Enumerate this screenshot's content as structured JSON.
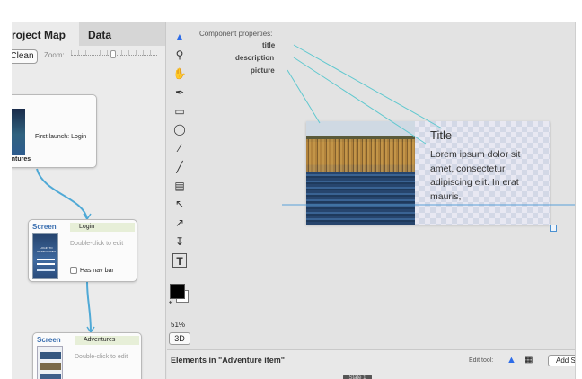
{
  "tabs": {
    "project_map": "roject Map",
    "data": "Data"
  },
  "toolbar": {
    "clean": "Clean",
    "zoom_label": "Zoom:"
  },
  "map": {
    "first": {
      "side_label": "n",
      "caption": "First launch: Login",
      "bottom": "ventures"
    },
    "login": {
      "header": "Screen",
      "name": "Login",
      "hint": "Double-click to edit",
      "navbar": "Has nav bar",
      "phone_text": "LOGIN TO ADVENTURES"
    },
    "adventures": {
      "header": "Screen",
      "name": "Adventures",
      "hint": "Double-click to edit"
    }
  },
  "tools": {
    "icons": [
      "pointer-icon",
      "magnifier-icon",
      "hand-icon",
      "pen-icon",
      "rectangle-icon",
      "oval-icon",
      "brush-icon",
      "line-icon",
      "gradient-icon",
      "direct-select-icon",
      "add-point-icon",
      "text-height-icon",
      "text-icon"
    ],
    "zoom_pct": "51%",
    "btn_3d": "3D"
  },
  "canvas": {
    "props_title": "Component properties:",
    "props": [
      "title",
      "description",
      "picture"
    ],
    "item": {
      "title": "Title",
      "description": "Lorem ipsum dolor sit amet, consectetur adipiscing elit. In erat mauris,"
    }
  },
  "bottom": {
    "elements_label": "Elements in \"Adventure item\"",
    "edit_tool": "Edit tool:",
    "add": "Add S",
    "state": "State 1"
  },
  "colors": {
    "accent": "#2d6ce8",
    "screen_header": "#3a6fb0",
    "connector": "#4fa9d6",
    "guide": "#5fc8cf"
  }
}
